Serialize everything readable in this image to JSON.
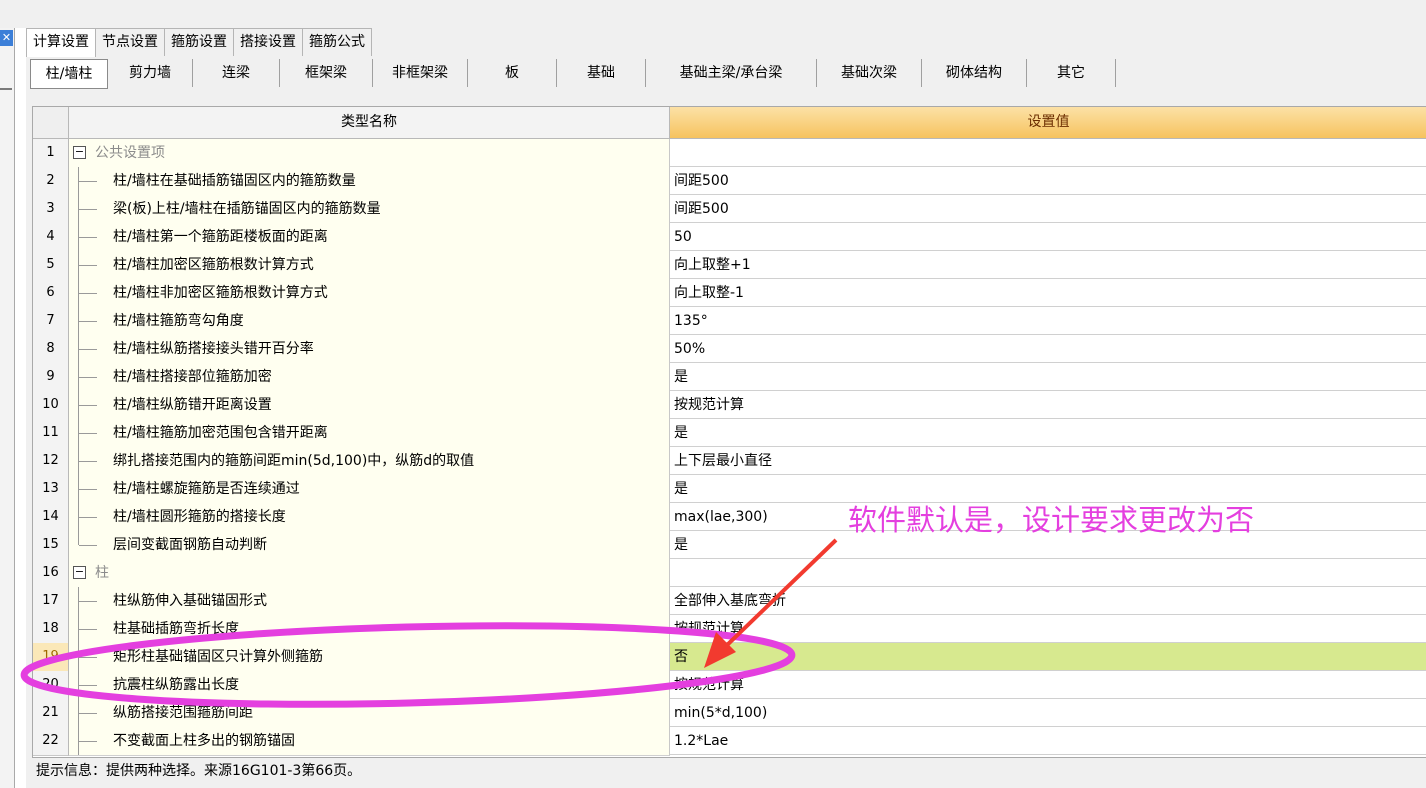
{
  "tabs_top": [
    "计算设置",
    "节点设置",
    "箍筋设置",
    "搭接设置",
    "箍筋公式"
  ],
  "tabs_sub": [
    "柱/墙柱",
    "剪力墙",
    "连梁",
    "框架梁",
    "非框架梁",
    "板",
    "基础",
    "基础主梁/承台梁",
    "基础次梁",
    "砌体结构",
    "其它"
  ],
  "grid": {
    "header_name": "类型名称",
    "header_value": "设置值",
    "rows": [
      {
        "n": "1",
        "name": "公共设置项",
        "value": ""
      },
      {
        "n": "2",
        "name": "柱/墙柱在基础插筋锚固区内的箍筋数量",
        "value": "间距500"
      },
      {
        "n": "3",
        "name": "梁(板)上柱/墙柱在插筋锚固区内的箍筋数量",
        "value": "间距500"
      },
      {
        "n": "4",
        "name": "柱/墙柱第一个箍筋距楼板面的距离",
        "value": "50"
      },
      {
        "n": "5",
        "name": "柱/墙柱加密区箍筋根数计算方式",
        "value": "向上取整+1"
      },
      {
        "n": "6",
        "name": "柱/墙柱非加密区箍筋根数计算方式",
        "value": "向上取整-1"
      },
      {
        "n": "7",
        "name": "柱/墙柱箍筋弯勾角度",
        "value": "135°"
      },
      {
        "n": "8",
        "name": "柱/墙柱纵筋搭接接头错开百分率",
        "value": "50%"
      },
      {
        "n": "9",
        "name": "柱/墙柱搭接部位箍筋加密",
        "value": "是"
      },
      {
        "n": "10",
        "name": "柱/墙柱纵筋错开距离设置",
        "value": "按规范计算"
      },
      {
        "n": "11",
        "name": "柱/墙柱箍筋加密范围包含错开距离",
        "value": "是"
      },
      {
        "n": "12",
        "name": "绑扎搭接范围内的箍筋间距min(5d,100)中，纵筋d的取值",
        "value": "上下层最小直径"
      },
      {
        "n": "13",
        "name": "柱/墙柱螺旋箍筋是否连续通过",
        "value": "是"
      },
      {
        "n": "14",
        "name": "柱/墙柱圆形箍筋的搭接长度",
        "value": "max(lae,300)"
      },
      {
        "n": "15",
        "name": "层间变截面钢筋自动判断",
        "value": "是"
      },
      {
        "n": "16",
        "name": "柱",
        "value": ""
      },
      {
        "n": "17",
        "name": "柱纵筋伸入基础锚固形式",
        "value": "全部伸入基底弯折"
      },
      {
        "n": "18",
        "name": "柱基础插筋弯折长度",
        "value": "按规范计算"
      },
      {
        "n": "19",
        "name": "矩形柱基础锚固区只计算外侧箍筋",
        "value": "否"
      },
      {
        "n": "20",
        "name": "抗震柱纵筋露出长度",
        "value": "按规范计算"
      },
      {
        "n": "21",
        "name": "纵筋搭接范围箍筋间距",
        "value": "min(5*d,100)"
      },
      {
        "n": "22",
        "name": "不变截面上柱多出的钢筋锚固",
        "value": "1.2*Lae"
      }
    ]
  },
  "status_text": "提示信息：提供两种选择。来源16G101-3第66页。",
  "annotation_text": "软件默认是，设计要求更改为否",
  "colors": {
    "annotation": "#e43fdf",
    "header_value_bg": "#f6c35f",
    "selected_value_bg": "#d7e98f",
    "arrow": "#f23a2f"
  }
}
